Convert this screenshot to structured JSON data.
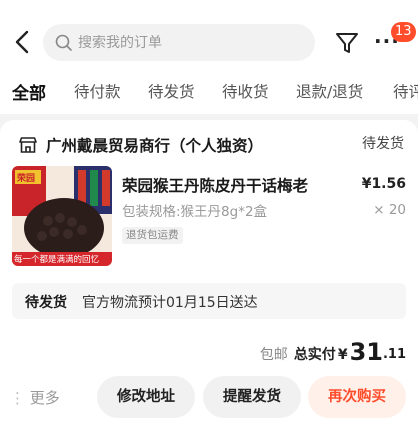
{
  "header": {
    "search_placeholder": "搜索我的订单",
    "message_count": "13"
  },
  "tabs": [
    {
      "label": "全部",
      "active": true
    },
    {
      "label": "待付款"
    },
    {
      "label": "待发货"
    },
    {
      "label": "待收货"
    },
    {
      "label": "退款/退货"
    },
    {
      "label": "待评"
    }
  ],
  "order": {
    "shop_name": "广州戴晨贸易商行（个人独资）",
    "status": "待发货",
    "product": {
      "title": "荣园猴王丹陈皮丹干话梅老",
      "price": "¥1.56",
      "spec": "包装规格:猴王丹8g*2盒",
      "quantity": "× 20",
      "tag": "退货包运费",
      "image_banner": "每一个都是满满的回忆",
      "image_brand": "荣园"
    },
    "shipping": {
      "status": "待发货",
      "info": "官方物流预计01月15日送达"
    },
    "total": {
      "shipping_note": "包邮",
      "label": "总实付",
      "currency": "¥",
      "amount_int": "31",
      "amount_dec": ".11"
    },
    "actions": {
      "more": "更多",
      "modify_address": "修改地址",
      "remind_ship": "提醒发货",
      "buy_again": "再次购买"
    }
  },
  "colors": {
    "accent": "#ff4d2c",
    "accent_bg": "#fff0ea",
    "background": "#f3f3f3"
  }
}
